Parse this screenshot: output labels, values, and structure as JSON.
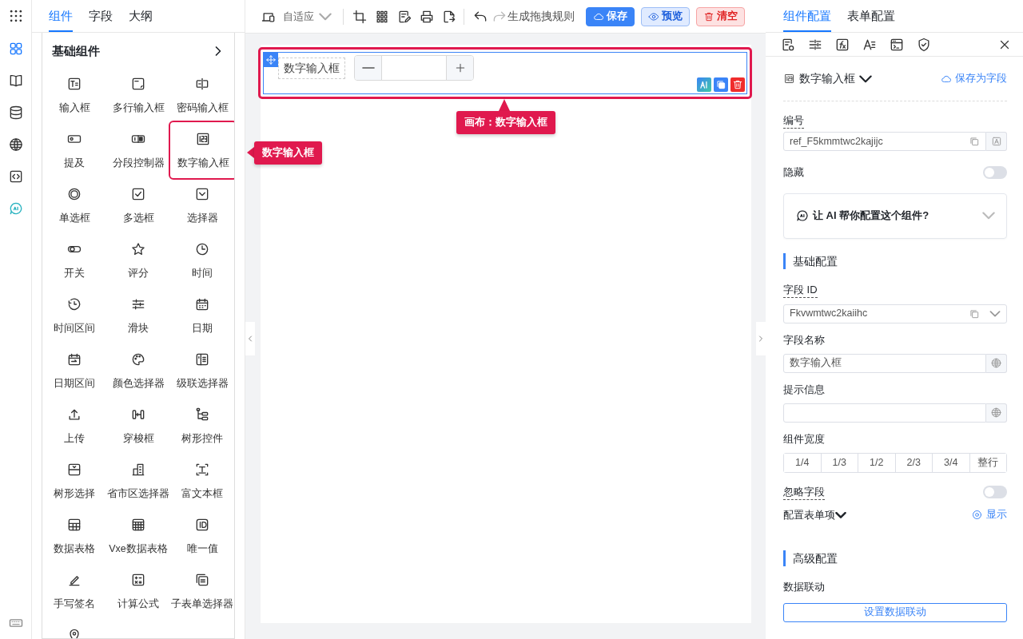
{
  "rail": {
    "items": [
      {
        "selected": true
      },
      {
        "selected": false
      },
      {
        "selected": false
      },
      {
        "selected": false
      },
      {
        "selected": false
      },
      {
        "selected": false
      }
    ]
  },
  "left_tabs": [
    {
      "label": "组件",
      "selected": true
    },
    {
      "label": "字段",
      "selected": false
    },
    {
      "label": "大纲",
      "selected": false
    }
  ],
  "palette": {
    "title": "基础组件",
    "items": [
      {
        "label": "输入框",
        "highlighted": false
      },
      {
        "label": "多行输入框",
        "highlighted": false
      },
      {
        "label": "密码输入框",
        "highlighted": false
      },
      {
        "label": "提及",
        "highlighted": false
      },
      {
        "label": "分段控制器",
        "highlighted": false
      },
      {
        "label": "数字输入框",
        "highlighted": true
      },
      {
        "label": "单选框",
        "highlighted": false
      },
      {
        "label": "多选框",
        "highlighted": false
      },
      {
        "label": "选择器",
        "highlighted": false
      },
      {
        "label": "开关",
        "highlighted": false
      },
      {
        "label": "评分",
        "highlighted": false
      },
      {
        "label": "时间",
        "highlighted": false
      },
      {
        "label": "时间区间",
        "highlighted": false
      },
      {
        "label": "滑块",
        "highlighted": false
      },
      {
        "label": "日期",
        "highlighted": false
      },
      {
        "label": "日期区间",
        "highlighted": false
      },
      {
        "label": "颜色选择器",
        "highlighted": false
      },
      {
        "label": "级联选择器",
        "highlighted": false
      },
      {
        "label": "上传",
        "highlighted": false
      },
      {
        "label": "穿梭框",
        "highlighted": false
      },
      {
        "label": "树形控件",
        "highlighted": false
      },
      {
        "label": "树形选择",
        "highlighted": false
      },
      {
        "label": "省市区选择器",
        "highlighted": false
      },
      {
        "label": "富文本框",
        "highlighted": false
      },
      {
        "label": "数据表格",
        "highlighted": false
      },
      {
        "label": "Vxe数据表格",
        "highlighted": false
      },
      {
        "label": "唯一值",
        "highlighted": false
      },
      {
        "label": "手写签名",
        "highlighted": false
      },
      {
        "label": "计算公式",
        "highlighted": false
      },
      {
        "label": "子表单选择器",
        "highlighted": false
      }
    ]
  },
  "toolbar": {
    "layout": "自适应",
    "redo_disabled": true,
    "rule_label": "生成拖拽规则",
    "buttons": [
      {
        "label": "保存",
        "kind": "primary"
      },
      {
        "label": "预览",
        "kind": "preview"
      },
      {
        "label": "清空",
        "kind": "danger"
      }
    ]
  },
  "canvas": {
    "widget": {
      "label": "数字输入框",
      "highlighted": true
    }
  },
  "callouts": [
    {
      "text": "数字输入框",
      "kind": "left"
    },
    {
      "text": "画布：数字输入框",
      "kind": "up"
    }
  ],
  "right": {
    "tabs": [
      {
        "label": "组件配置",
        "selected": true
      },
      {
        "label": "表单配置",
        "selected": false
      }
    ],
    "component": "数字输入框",
    "save_as_field": "保存为字段",
    "ref": {
      "label": "编号",
      "value": "ref_F5kmmtwc2kajijc"
    },
    "hidden": {
      "label": "隐藏",
      "on": false
    },
    "ai_prompt": "让 AI 帮你配置这个组件?",
    "basic": {
      "title": "基础配置",
      "field_id": {
        "label": "字段 ID",
        "value": "Fkvwmtwc2kaiihc"
      },
      "field_name": {
        "label": "字段名称",
        "value": "数字输入框"
      },
      "hint": {
        "label": "提示信息"
      },
      "width": {
        "label": "组件宽度",
        "options": [
          {
            "label": "1/4",
            "selected": false
          },
          {
            "label": "1/3",
            "selected": false
          },
          {
            "label": "1/2",
            "selected": false
          },
          {
            "label": "2/3",
            "selected": false
          },
          {
            "label": "3/4",
            "selected": false
          },
          {
            "label": "整行",
            "selected": false
          }
        ]
      },
      "ignore": {
        "label": "忽略字段",
        "on": false
      },
      "form_item": {
        "label": "配置表单项",
        "action": "显示"
      }
    },
    "advanced": {
      "title": "高级配置",
      "linkage": {
        "label": "数据联动",
        "button": "设置数据联动"
      }
    }
  }
}
